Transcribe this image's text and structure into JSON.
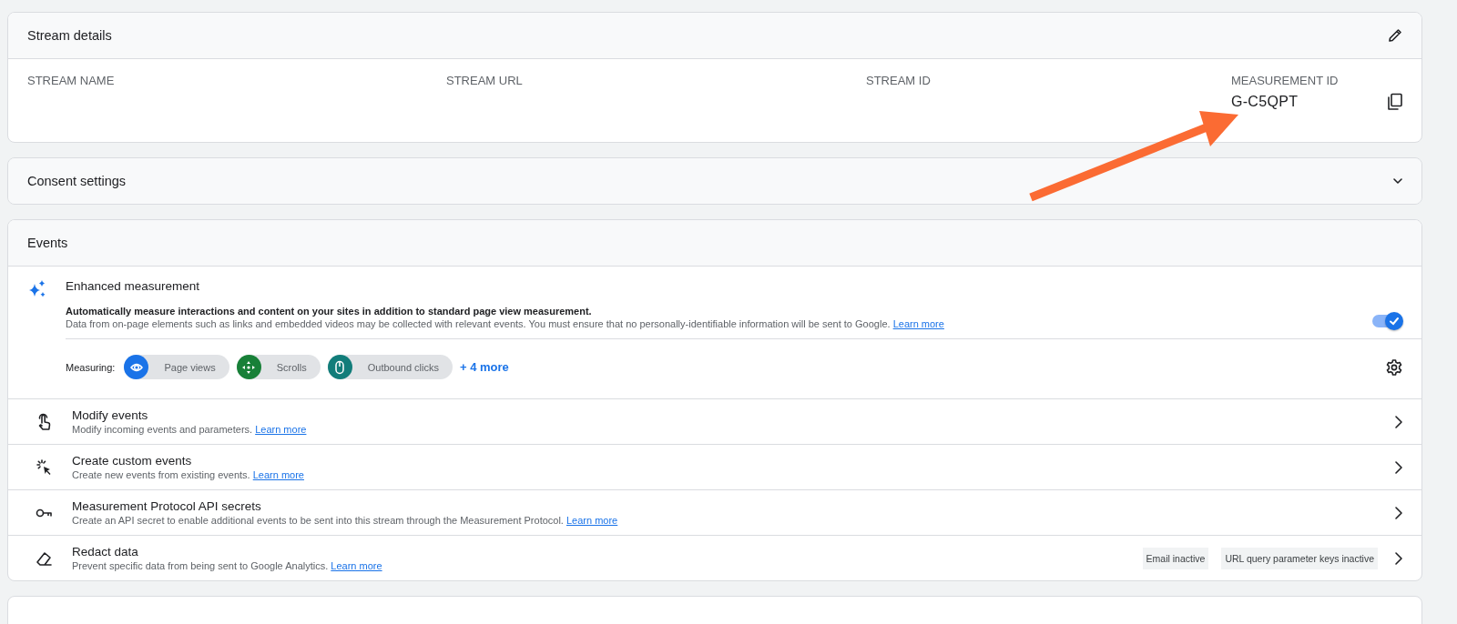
{
  "stream_details": {
    "title": "Stream details",
    "columns": [
      {
        "label": "STREAM NAME"
      },
      {
        "label": "STREAM URL"
      },
      {
        "label": "STREAM ID"
      },
      {
        "label": "MEASUREMENT ID",
        "value": "G-C5QPT"
      }
    ]
  },
  "consent_settings": {
    "title": "Consent settings",
    "expanded": false
  },
  "events": {
    "title": "Events",
    "enhanced_measurement": {
      "title": "Enhanced measurement",
      "description": "Automatically measure interactions and content on your sites in addition to standard page view measurement.",
      "detail": "Data from on-page elements such as links and embedded videos may be collected with relevant events. You must ensure that no personally-identifiable information will be sent to Google.",
      "link": "Learn more",
      "on": true,
      "measuring_label": "Measuring:",
      "chips": [
        {
          "kind": "eye",
          "label": "Page views",
          "color": "#1a73e8"
        },
        {
          "kind": "move",
          "label": "Scrolls",
          "color": "#188038"
        },
        {
          "kind": "mouse",
          "label": "Outbound clicks",
          "color": "#127d7a"
        }
      ],
      "more": "+ 4 more"
    },
    "rows": [
      {
        "kind": "touch",
        "title": "Modify events",
        "description": "Modify incoming events and parameters.",
        "link": "Learn more"
      },
      {
        "kind": "click",
        "title": "Create custom events",
        "description": "Create new events from existing events.",
        "link": "Learn more"
      },
      {
        "kind": "key",
        "title": "Measurement Protocol API secrets",
        "description": "Create an API secret to enable additional events to be sent into this stream through the Measurement Protocol.",
        "link": "Learn more"
      },
      {
        "kind": "eraser",
        "title": "Redact data",
        "description": "Prevent specific data from being sent to Google Analytics.",
        "link": "Learn more",
        "tags": [
          "Email inactive",
          "URL query parameter keys inactive"
        ]
      }
    ]
  }
}
